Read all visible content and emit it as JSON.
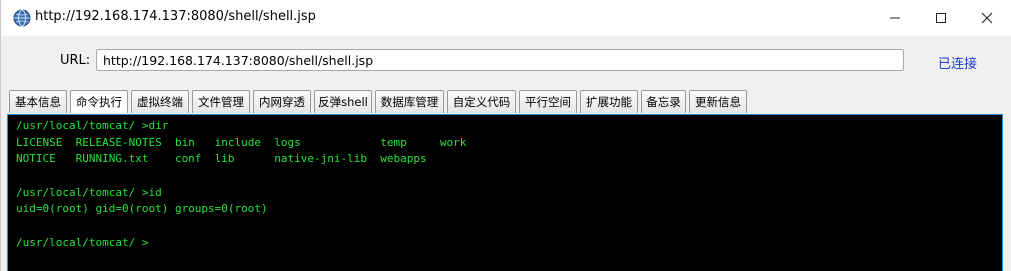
{
  "window": {
    "title": "http://192.168.174.137:8080/shell/shell.jsp",
    "minimize_glyph": "—",
    "maximize_glyph": "☐",
    "close_glyph": "✕"
  },
  "address": {
    "label": "URL:",
    "value": "http://192.168.174.137:8080/shell/shell.jsp",
    "status": "已连接"
  },
  "tabs": [
    {
      "label": "基本信息",
      "active": false
    },
    {
      "label": "命令执行",
      "active": true
    },
    {
      "label": "虚拟终端",
      "active": false
    },
    {
      "label": "文件管理",
      "active": false
    },
    {
      "label": "内网穿透",
      "active": false
    },
    {
      "label": "反弹shell",
      "active": false
    },
    {
      "label": "数据库管理",
      "active": false
    },
    {
      "label": "自定义代码",
      "active": false
    },
    {
      "label": "平行空间",
      "active": false
    },
    {
      "label": "扩展功能",
      "active": false
    },
    {
      "label": "备忘录",
      "active": false
    },
    {
      "label": "更新信息",
      "active": false
    }
  ],
  "terminal": {
    "lines": [
      "/usr/local/tomcat/ >dir",
      "LICENSE  RELEASE-NOTES  bin   include  logs            temp     work",
      "NOTICE   RUNNING.txt    conf  lib      native-jni-lib  webapps",
      "",
      "/usr/local/tomcat/ >id",
      "uid=0(root) gid=0(root) groups=0(root)",
      "",
      "/usr/local/tomcat/ >"
    ]
  },
  "colors": {
    "terminal_bg": "#000000",
    "terminal_text": "#22e23a",
    "status_link": "#1a3bd6",
    "terminal_border": "#2c8fd6"
  }
}
